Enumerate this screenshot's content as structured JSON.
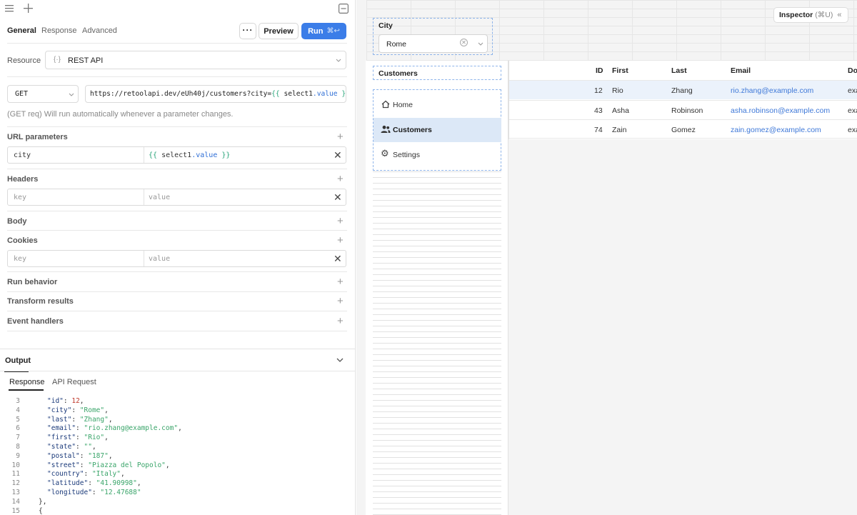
{
  "left": {
    "tabs": [
      "General",
      "Response",
      "Advanced"
    ],
    "preview_label": "Preview",
    "run_label": "Run",
    "run_shortcut": "⌘↩",
    "resource_label": "Resource",
    "resource_value": "REST API",
    "method": "GET",
    "url_prefix": "https://retoolapi.dev/eUh40j/customers?city=",
    "url_tmpl_open": "{{ ",
    "url_tmpl_var": "select1",
    "url_tmpl_prop": ".value",
    "url_tmpl_close": " }}",
    "run_note": "(GET req) Will run automatically whenever a parameter changes.",
    "sections": {
      "url_parameters": "URL parameters",
      "headers": "Headers",
      "body": "Body",
      "cookies": "Cookies",
      "run_behavior": "Run behavior",
      "transform_results": "Transform results",
      "event_handlers": "Event handlers"
    },
    "url_param": {
      "key": "city",
      "value_open": "{{ ",
      "value_var": "select1",
      "value_prop": ".value",
      "value_close": " }}"
    },
    "key_placeholder": "key",
    "value_placeholder": "value"
  },
  "output": {
    "title": "Output",
    "tabs": [
      "Response",
      "API Request"
    ],
    "lines": [
      {
        "n": "3",
        "k": "\"id\"",
        "v": "12",
        "t": "num",
        "c": ","
      },
      {
        "n": "4",
        "k": "\"city\"",
        "v": "\"Rome\"",
        "t": "str",
        "c": ","
      },
      {
        "n": "5",
        "k": "\"last\"",
        "v": "\"Zhang\"",
        "t": "str",
        "c": ","
      },
      {
        "n": "6",
        "k": "\"email\"",
        "v": "\"rio.zhang@example.com\"",
        "t": "str",
        "c": ","
      },
      {
        "n": "7",
        "k": "\"first\"",
        "v": "\"Rio\"",
        "t": "str",
        "c": ","
      },
      {
        "n": "8",
        "k": "\"state\"",
        "v": "\"\"",
        "t": "str",
        "c": ","
      },
      {
        "n": "9",
        "k": "\"postal\"",
        "v": "\"187\"",
        "t": "str",
        "c": ","
      },
      {
        "n": "10",
        "k": "\"street\"",
        "v": "\"Piazza del Popolo\"",
        "t": "str",
        "c": ","
      },
      {
        "n": "11",
        "k": "\"country\"",
        "v": "\"Italy\"",
        "t": "str",
        "c": ","
      },
      {
        "n": "12",
        "k": "\"latitude\"",
        "v": "\"41.90998\"",
        "t": "str",
        "c": ","
      },
      {
        "n": "13",
        "k": "\"longitude\"",
        "v": "\"12.47688\"",
        "t": "str",
        "c": ""
      }
    ],
    "close_line_num": "14",
    "close_line_text": "},",
    "next_line_num": "15",
    "next_line_text": "{"
  },
  "canvas": {
    "inspector_label": "Inspector",
    "inspector_shortcut": "(⌘U)",
    "city_label": "City",
    "city_value": "Rome",
    "customers_label": "Customers",
    "nav_items": [
      "Home",
      "Customers",
      "Settings"
    ],
    "table": {
      "headers": [
        "ID",
        "First",
        "Last",
        "Email",
        "Do"
      ],
      "rows": [
        {
          "id": "12",
          "first": "Rio",
          "last": "Zhang",
          "email": "rio.zhang@example.com",
          "extra": "exa"
        },
        {
          "id": "43",
          "first": "Asha",
          "last": "Robinson",
          "email": "asha.robinson@example.com",
          "extra": "exa"
        },
        {
          "id": "74",
          "first": "Zain",
          "last": "Gomez",
          "email": "zain.gomez@example.com",
          "extra": "exa"
        }
      ]
    }
  },
  "colors": {
    "accent": "#3b7de8",
    "template_green": "#2aa57a",
    "selected_row": "#ebf2fb",
    "nav_active": "#dce8f7"
  }
}
